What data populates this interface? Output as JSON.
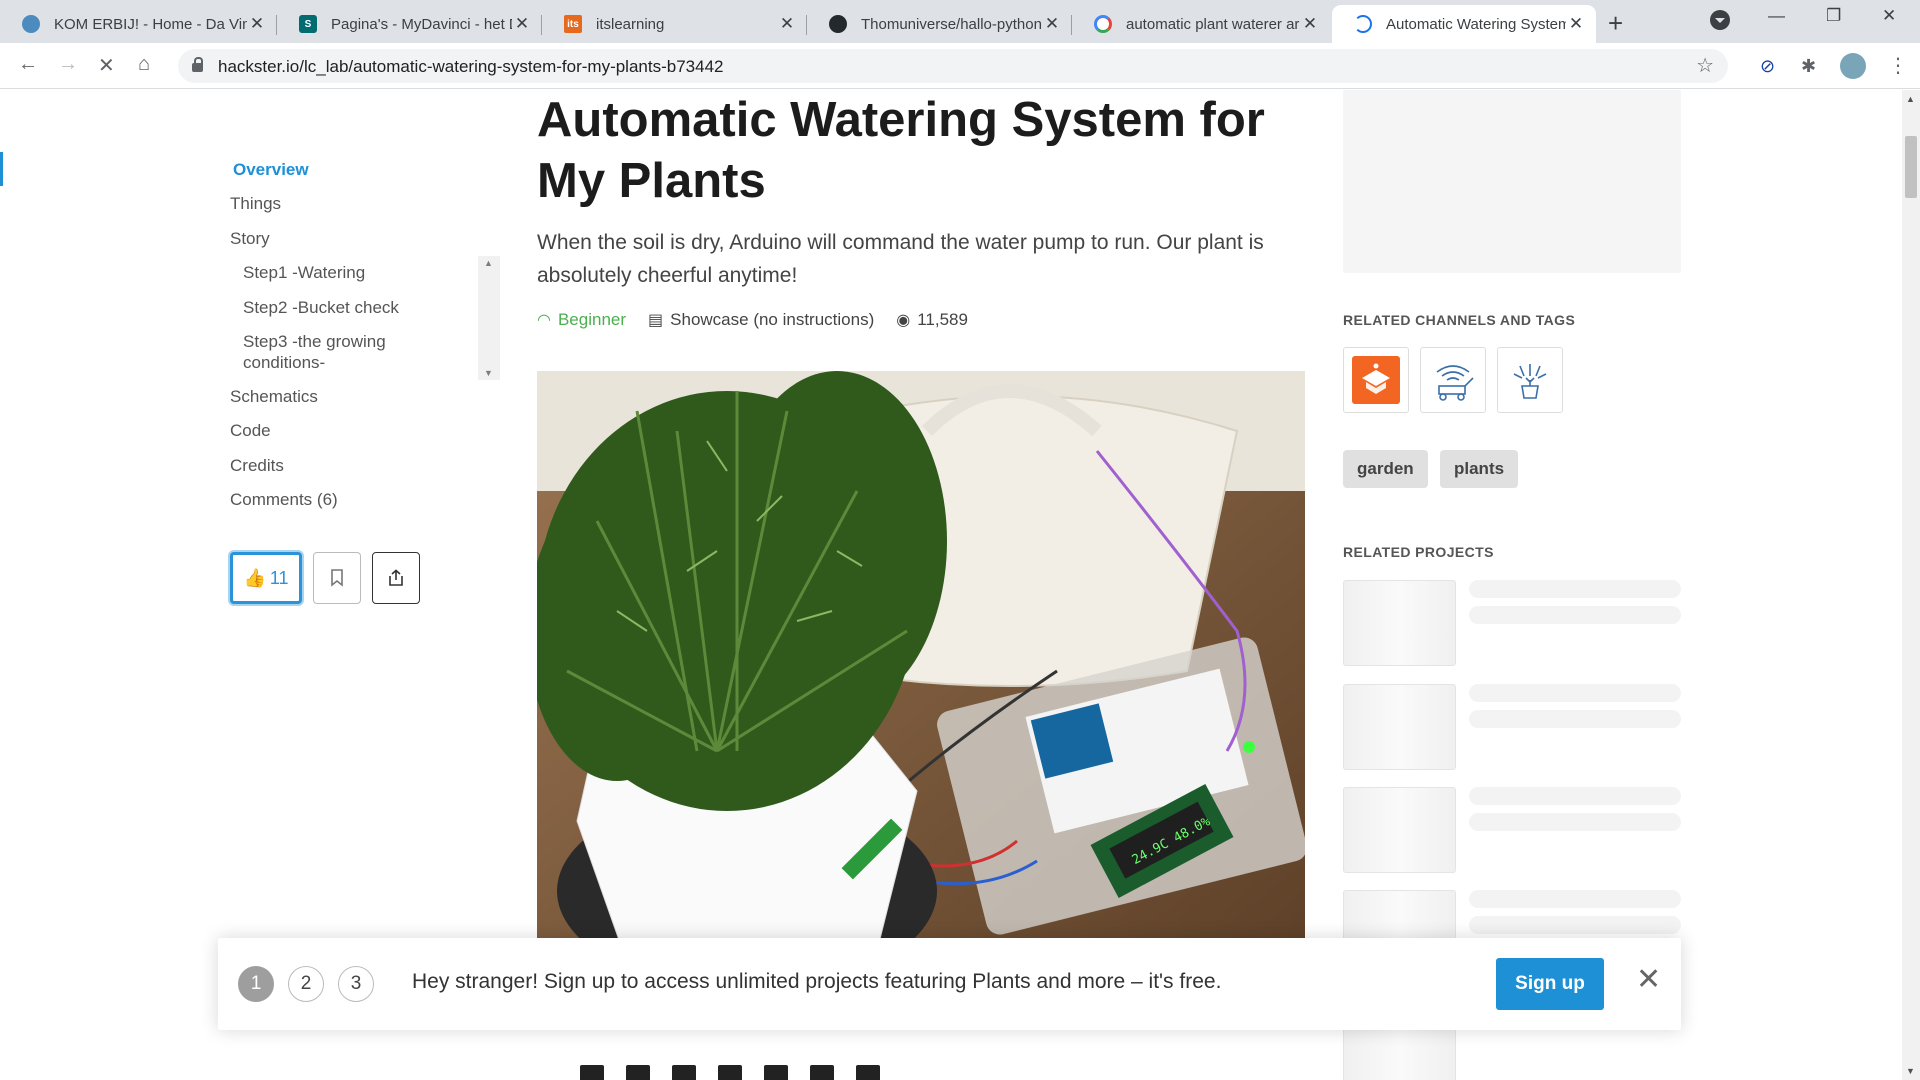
{
  "browser": {
    "tabs": [
      {
        "title": "KOM ERBIJ! - Home - Da Vinci",
        "favicon": "davinci-icon",
        "color": "#4b8bbe"
      },
      {
        "title": "Pagina's - MyDavinci - het Da Vinci",
        "favicon": "sharepoint-icon",
        "color": "#036c70"
      },
      {
        "title": "itslearning",
        "favicon": "itslearning-icon",
        "color": "#e66a1e"
      },
      {
        "title": "Thomuniverse/hallo-python",
        "favicon": "github-icon",
        "color": "#24292e"
      },
      {
        "title": "automatic plant waterer arduino",
        "favicon": "google-icon",
        "color": "#4285f4"
      },
      {
        "title": "Automatic Watering System for My Plants",
        "favicon": "loading-icon",
        "color": "#1a73e8"
      }
    ],
    "address": "hackster.io/lc_lab/automatic-watering-system-for-my-plants-b73442"
  },
  "toc": {
    "items": [
      {
        "label": "Overview",
        "active": true,
        "indent": 0
      },
      {
        "label": "Things",
        "indent": 0
      },
      {
        "label": "Story",
        "indent": 0
      },
      {
        "label": "Step1 -Watering",
        "indent": 1
      },
      {
        "label": "Step2 -Bucket check",
        "indent": 1
      },
      {
        "label": "Step3 -the growing",
        "indent": 1
      },
      {
        "label": "conditions-",
        "indent": 1
      },
      {
        "label": "Schematics",
        "indent": 0
      },
      {
        "label": "Code",
        "indent": 0
      },
      {
        "label": "Credits",
        "indent": 0
      },
      {
        "label": "Comments (6)",
        "indent": 0
      }
    ],
    "like_count": "11"
  },
  "project": {
    "title": "Automatic Watering System for My Plants",
    "summary": "When the soil is dry, Arduino will command the water pump to run. Our plant is absolutely cheerful anytime!",
    "level": "Beginner",
    "type": "Showcase (no instructions)",
    "views": "11,589",
    "accent_green": "#4caf50"
  },
  "sidebar": {
    "channels_heading": "RELATED CHANNELS AND TAGS",
    "tags": [
      "garden",
      "plants"
    ],
    "projects_heading": "RELATED PROJECTS"
  },
  "signup": {
    "steps": [
      "1",
      "2",
      "3"
    ],
    "message": "Hey stranger! Sign up to access unlimited projects featuring Plants and more – it's free.",
    "button": "Sign up",
    "accent": "#1e90d6"
  }
}
